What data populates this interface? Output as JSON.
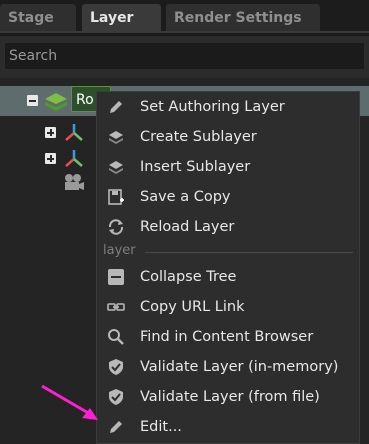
{
  "tabs": [
    {
      "label": "Stage",
      "active": false
    },
    {
      "label": "Layer",
      "active": true
    },
    {
      "label": "Render Settings",
      "active": false
    }
  ],
  "search": {
    "placeholder": "Search"
  },
  "tree": {
    "root_label": "Ro"
  },
  "menu": {
    "items": [
      {
        "label": "Set Authoring Layer",
        "icon": "pencil-icon"
      },
      {
        "label": "Create Sublayer",
        "icon": "layer-add-icon"
      },
      {
        "label": "Insert Sublayer",
        "icon": "layer-insert-icon"
      },
      {
        "label": "Save a Copy",
        "icon": "save-icon"
      },
      {
        "label": "Reload Layer",
        "icon": "reload-icon"
      }
    ],
    "section_label": "layer",
    "items2": [
      {
        "label": "Collapse Tree",
        "icon": "collapse-icon"
      },
      {
        "label": "Copy URL Link",
        "icon": "link-icon"
      },
      {
        "label": "Find in Content Browser",
        "icon": "search-icon"
      },
      {
        "label": "Validate Layer (in-memory)",
        "icon": "shield-check-icon"
      },
      {
        "label": "Validate Layer (from file)",
        "icon": "shield-check-icon"
      },
      {
        "label": "Edit...",
        "icon": "pencil-icon"
      }
    ]
  },
  "colors": {
    "accent_arrow": "#ff1fd2",
    "selection": "#5f6c6e"
  }
}
